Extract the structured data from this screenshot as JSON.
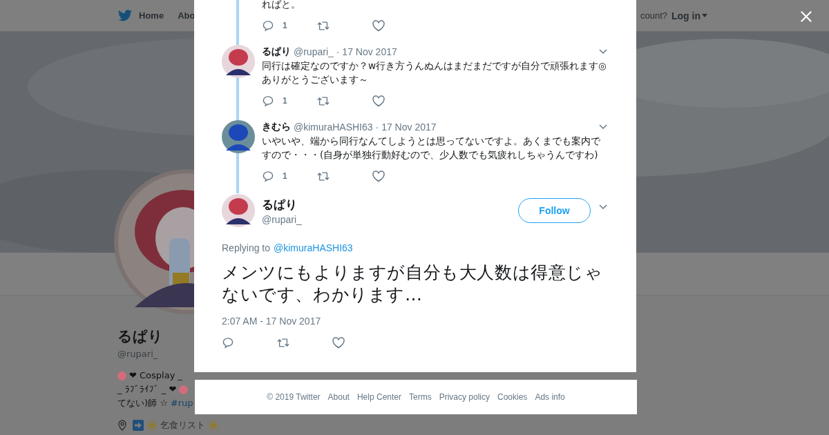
{
  "nav": {
    "home": "Home",
    "about": "Abo",
    "account_prompt": "count?",
    "login": "Log in"
  },
  "profile": {
    "name": "るぱり",
    "handle": "@rupari_",
    "bio_line1_a": "❤ Cosplay _",
    "bio_line2": "_ ﾗﾌﾞﾗｲﾌﾞ _ ❤",
    "bio_line3": "てない)師 ☆",
    "hashtag": "#rup",
    "list_label": "乞食リスト"
  },
  "thread": {
    "cut_text": "ればと。",
    "cut_reply_count": "1",
    "replies": [
      {
        "name": "るぱり",
        "handle": "@rupari_",
        "date": "· 17 Nov 2017",
        "text": "同行は確定なのですか？w行き方うんぬんはまだまだですが自分で頑張れます◎ありがとうございます～",
        "reply_count": "1"
      },
      {
        "name": "きむら",
        "handle": "@kimuraHASHI63",
        "date": "· 17 Nov 2017",
        "text": "いやいや、端から同行なんてしようとは思ってないですよ。あくまでも案内ですので・・・(自身が単独行動好むので、少人数でも気疲れしちゃうんですわ)",
        "reply_count": "1"
      }
    ]
  },
  "main_tweet": {
    "name": "るぱり",
    "handle": "@rupari_",
    "follow": "Follow",
    "replying_label": "Replying to",
    "replying_to": "@kimuraHASHI63",
    "text": "メンツにもよりますが自分も大人数は得意じゃないです、わかります…",
    "timestamp": "2:07 AM - 17 Nov 2017"
  },
  "footer": [
    "© 2019 Twitter",
    "About",
    "Help Center",
    "Terms",
    "Privacy policy",
    "Cookies",
    "Ads info"
  ]
}
